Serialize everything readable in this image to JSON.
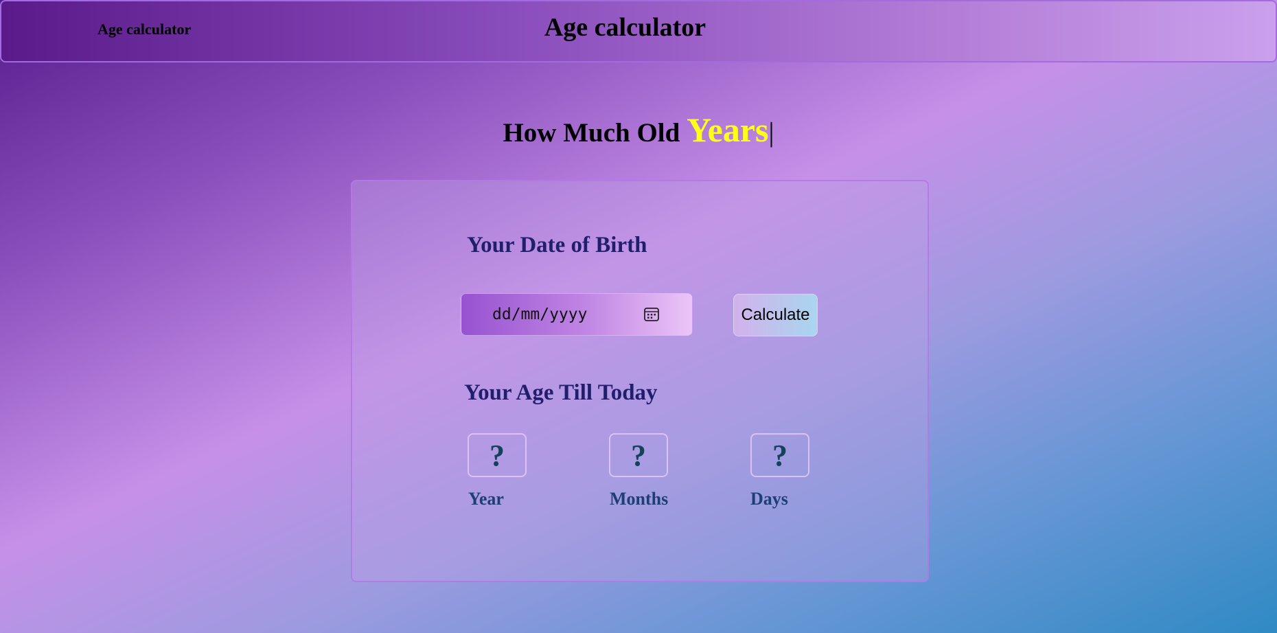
{
  "navbar": {
    "brand": "Age calculator",
    "title": "Age calculator"
  },
  "headline": {
    "prefix": "How Much Old ",
    "typed_word": "Years",
    "cursor": "|"
  },
  "card": {
    "dob_label": "Your Date of Birth",
    "date_input": {
      "placeholder": "dd/mm/yyyy",
      "icon": "calendar-icon"
    },
    "calculate_button": "Calculate",
    "age_label": "Your Age Till Today",
    "results": [
      {
        "value": "?",
        "label": "Year"
      },
      {
        "value": "?",
        "label": "Months"
      },
      {
        "value": "?",
        "label": "Days"
      }
    ]
  },
  "colors": {
    "typed_word": "#ffff1a",
    "label": "#1f1f6b",
    "result_value": "#14425a"
  }
}
